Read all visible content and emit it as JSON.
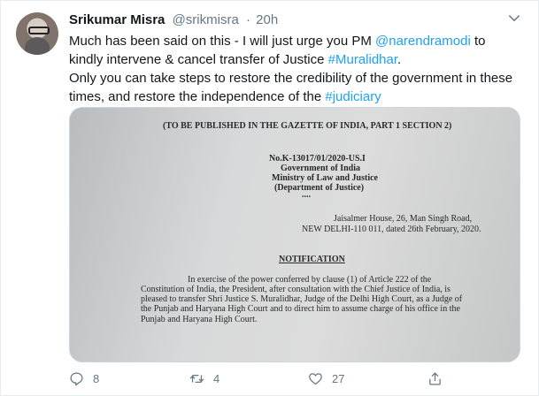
{
  "tweet": {
    "display_name": "Srikumar Misra",
    "handle": "@srikmisra",
    "separator": "·",
    "time": "20h",
    "text": {
      "part1": "Much has been said on this - I will just urge you PM ",
      "mention": "@narendramodi",
      "part2": " to kindly intervene & cancel transfer of Justice ",
      "hashtag1": "#Muralidhar",
      "part3": ".",
      "part4": "Only you can take steps to restore the credibility of the government in these times, and restore the independence of the ",
      "hashtag2": "#judiciary"
    },
    "document": {
      "heading": "(TO BE PUBLISHED IN THE GAZETTE OF INDIA, PART 1 SECTION 2)",
      "ref_no": "No.K-13017/01/2020-US.I",
      "gov": "Government of India",
      "ministry": "Ministry of Law and Justice",
      "dept": "(Department of Justice)",
      "dots": "....",
      "address1": "Jaisalmer House, 26, Man Singh Road,",
      "address2": "NEW DELHI-110 011, dated 26th February, 2020.",
      "notification": "NOTIFICATION",
      "body1": "In exercise of the power conferred by clause (1) of Article 222 of the",
      "body2": "Constitution of India, the President, after consultation with the Chief Justice of India, is",
      "body3": "pleased to transfer Shri Justice S. Muralidhar, Judge of the Delhi High Court, as a Judge of",
      "body4": "the Punjab and Haryana High Court and to direct him to assume charge of his office in the",
      "body5": "Punjab and Haryana High Court."
    },
    "actions": {
      "reply_count": "8",
      "retweet_count": "4",
      "like_count": "27"
    }
  },
  "colors": {
    "link": "#1da1f2",
    "secondary_text": "#657786"
  },
  "icons": [
    "caret-down-icon",
    "reply-icon",
    "retweet-icon",
    "like-icon",
    "share-icon"
  ]
}
